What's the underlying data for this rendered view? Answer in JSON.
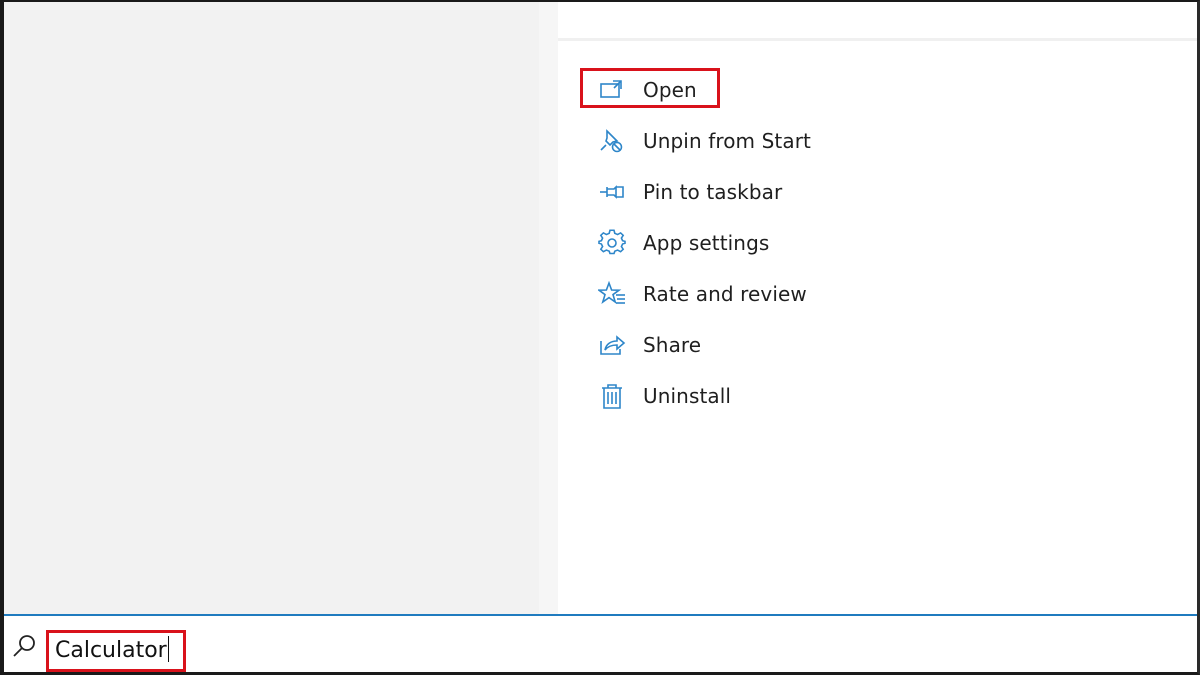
{
  "context_menu": {
    "items": [
      {
        "id": "open",
        "label": "Open",
        "icon": "open-window-icon"
      },
      {
        "id": "unpin",
        "label": "Unpin from Start",
        "icon": "unpin-icon"
      },
      {
        "id": "pin-taskbar",
        "label": "Pin to taskbar",
        "icon": "pin-icon"
      },
      {
        "id": "app-settings",
        "label": "App settings",
        "icon": "gear-icon"
      },
      {
        "id": "rate-review",
        "label": "Rate and review",
        "icon": "star-list-icon"
      },
      {
        "id": "share",
        "label": "Share",
        "icon": "share-icon"
      },
      {
        "id": "uninstall",
        "label": "Uninstall",
        "icon": "trash-icon"
      }
    ]
  },
  "search": {
    "value": "Calculator",
    "icon": "search-icon"
  },
  "colors": {
    "icon_blue": "#2e86c9",
    "highlight_red": "#d9121b",
    "search_border_blue": "#1f7bbf",
    "left_pane_bg": "#f2f2f2"
  }
}
